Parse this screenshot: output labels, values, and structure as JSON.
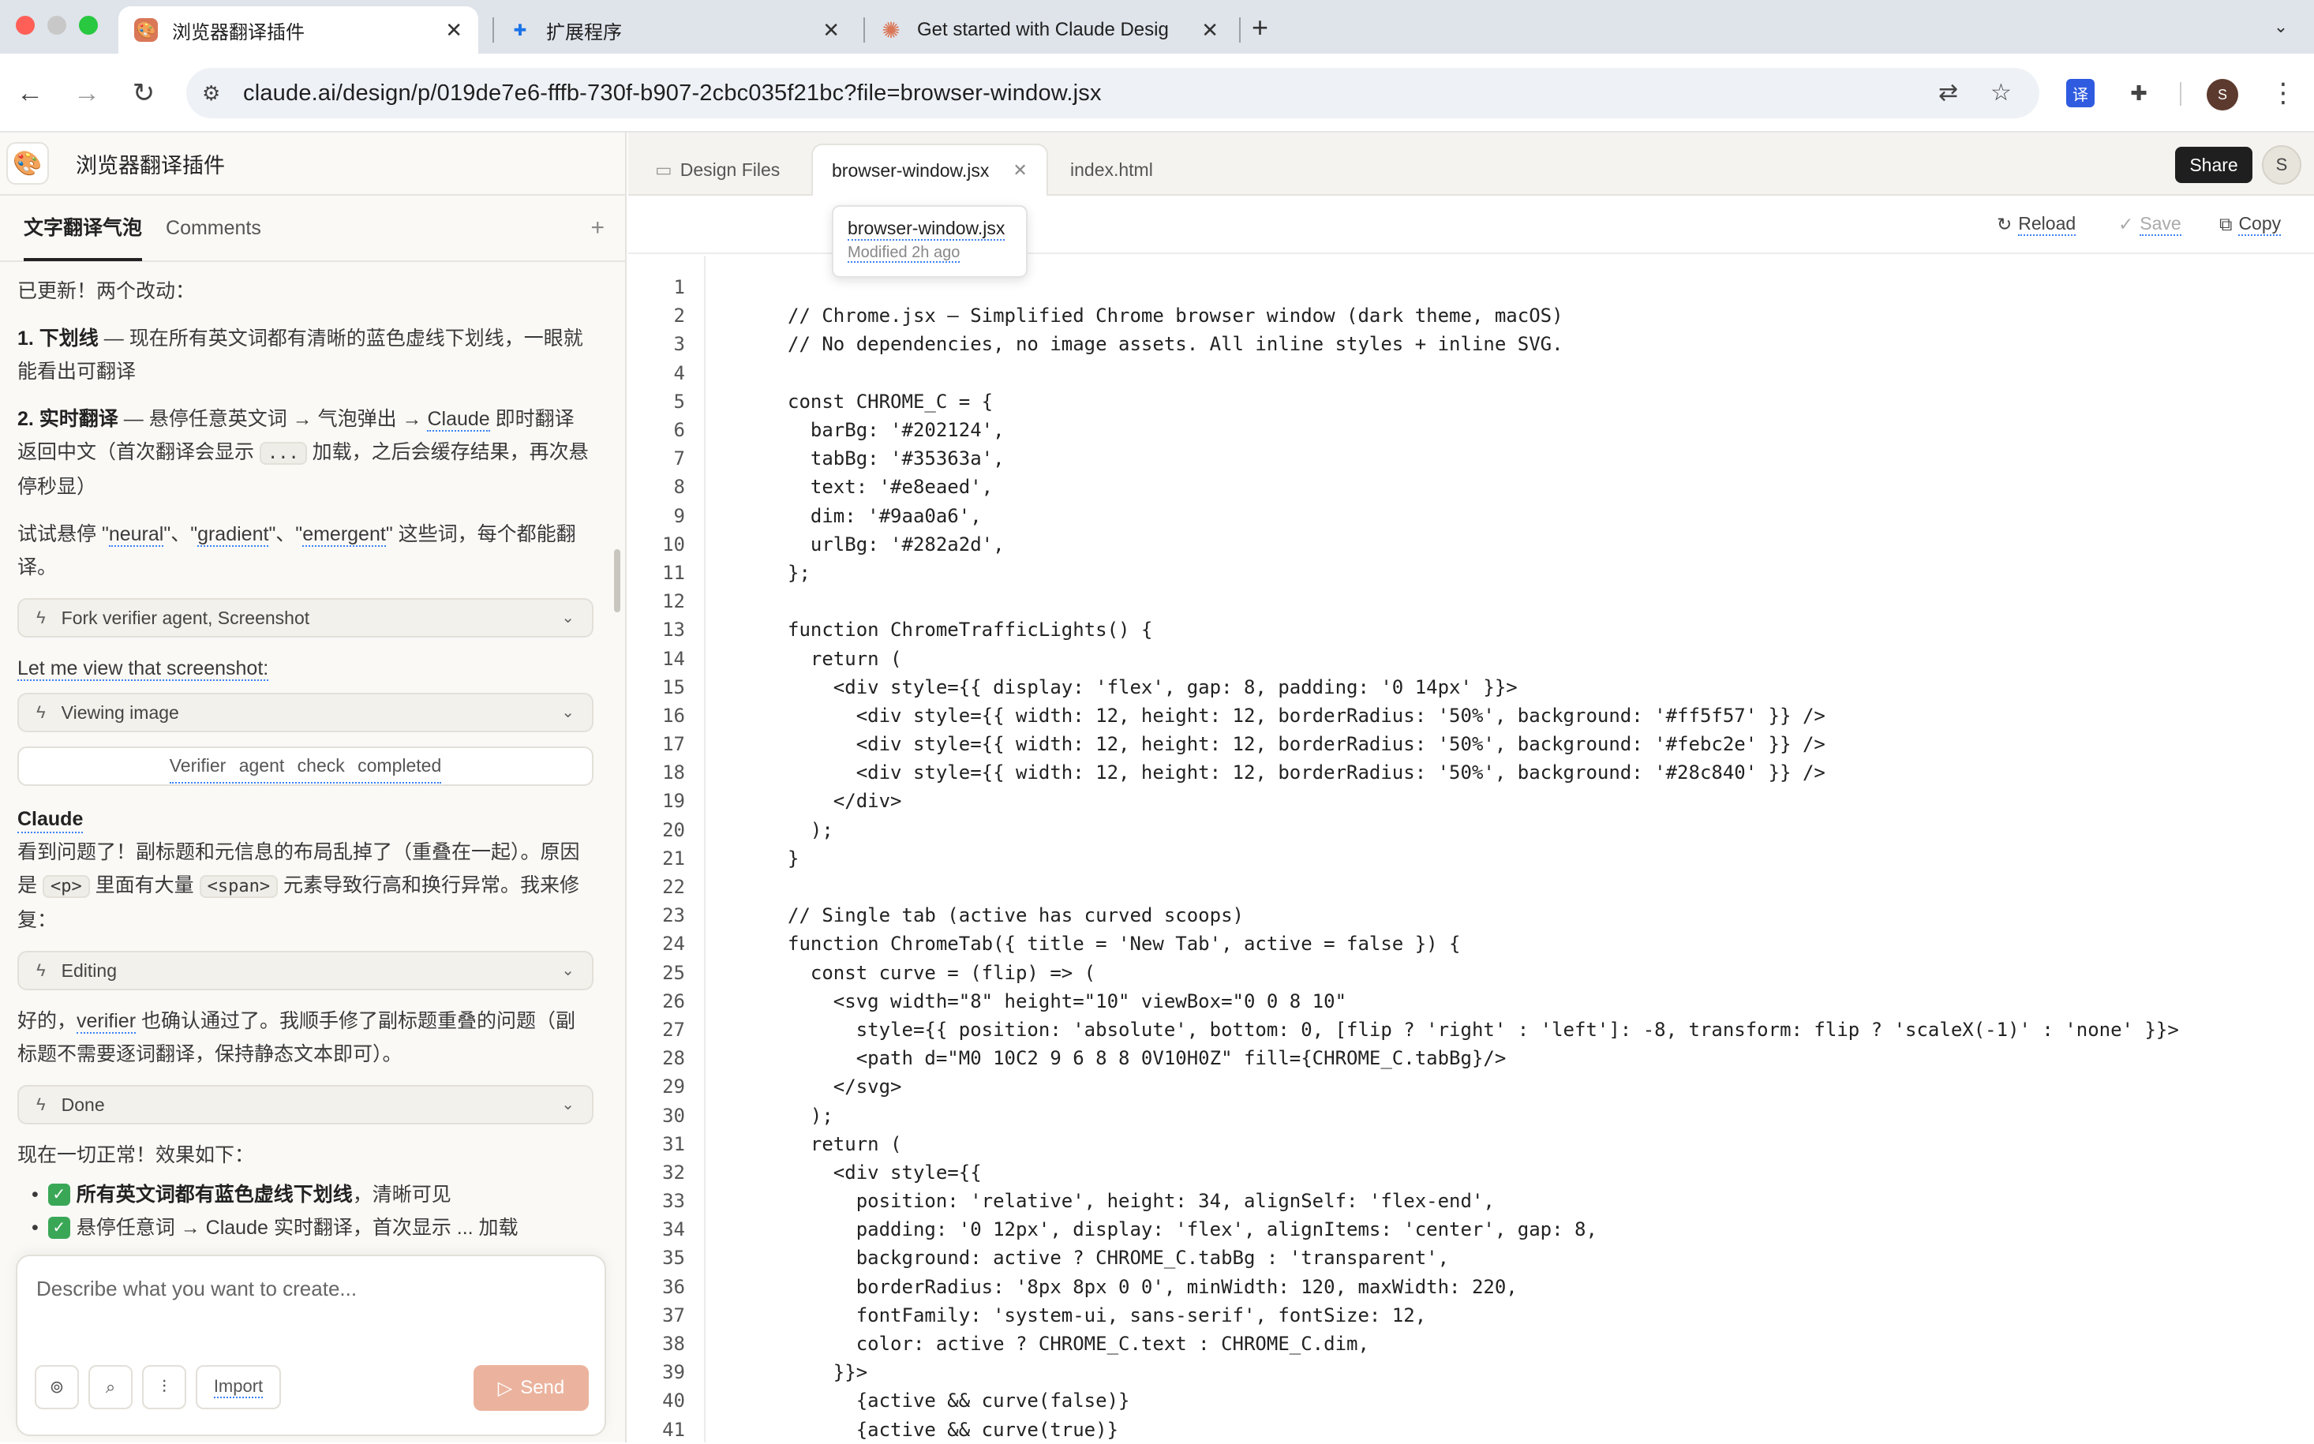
{
  "browser": {
    "tabs": [
      {
        "label": "浏览器翻译插件",
        "active": true
      },
      {
        "label": "扩展程序",
        "active": false
      },
      {
        "label": "Get started with Claude Desig",
        "active": false
      }
    ],
    "url": "claude.ai/design/p/019de7e6-fffb-730f-b907-2cbc035f21bc?file=browser-window.jsx",
    "profile_initial": "S",
    "translate_ext": "译"
  },
  "project": {
    "title": "浏览器翻译插件",
    "tabs": [
      {
        "label": "文字翻译气泡",
        "active": true
      },
      {
        "label": "Comments",
        "active": false
      }
    ]
  },
  "chat": {
    "intro": "已更新！两个改动：",
    "change1_title": "1. 下划线",
    "change1_text": " — 现在所有英文词都有清晰的蓝色虚线下划线，一眼就能看出可翻译",
    "change2_title": "2. 实时翻译",
    "change2_text_a": " — 悬停任意英文词 → 气泡弹出 → ",
    "change2_claude": "Claude",
    "change2_text_b": " 即时翻译返回中文（首次翻译会显示 ",
    "change2_code": "...",
    "change2_text_c": " 加载，之后会缓存结果，再次悬停秒显）",
    "try_a": "试试悬停 \"",
    "try_w1": "neural",
    "try_b": "\"、\"",
    "try_w2": "gradient",
    "try_c": "\"、\"",
    "try_w3": "emergent",
    "try_d": "\" 这些词，每个都能翻译。",
    "tool1": "Fork verifier agent, Screenshot",
    "view_text": "Let me view that screenshot:",
    "tool2": "Viewing image",
    "verifier": "Verifier agent check completed",
    "claude_label": "Claude",
    "problem_a": "看到问题了！副标题和元信息的布局乱掉了（重叠在一起）。原因是 ",
    "problem_code1": "<p>",
    "problem_b": " 里面有大量 ",
    "problem_code2": "<span>",
    "problem_c": " 元素导致行高和换行异常。我来修复：",
    "tool3": "Editing",
    "fixed_a": "好的，",
    "fixed_verifier": "verifier",
    "fixed_b": " 也确认通过了。我顺手修了副标题重叠的问题（副标题不需要逐词翻译，保持静态文本即可）。",
    "tool4": "Done",
    "summary": "现在一切正常！效果如下：",
    "bullet1_bold": "所有英文词都有蓝色虚线下划线",
    "bullet1_rest": "，清晰可见",
    "bullet2": "悬停任意词 → Claude 实时翻译，首次显示 ... 加载"
  },
  "composer": {
    "placeholder": "Describe what you want to create...",
    "import_label": "Import",
    "send_label": "Send"
  },
  "editor": {
    "file_tabs": [
      {
        "label": "Design Files",
        "active": false
      },
      {
        "label": "browser-window.jsx",
        "active": true
      },
      {
        "label": "index.html",
        "active": false
      }
    ],
    "share_label": "Share",
    "avatar": "S",
    "reload_label": "Reload",
    "save_label": "Save",
    "copy_label": "Copy",
    "tooltip_name": "browser-window.jsx",
    "tooltip_meta": "Modified 2h ago",
    "lines": [
      "",
      "// Chrome.jsx — Simplified Chrome browser window (dark theme, macOS)",
      "// No dependencies, no image assets. All inline styles + inline SVG.",
      "",
      "const CHROME_C = {",
      "  barBg: '#202124',",
      "  tabBg: '#35363a',",
      "  text: '#e8eaed',",
      "  dim: '#9aa0a6',",
      "  urlBg: '#282a2d',",
      "};",
      "",
      "function ChromeTrafficLights() {",
      "  return (",
      "    <div style={{ display: 'flex', gap: 8, padding: '0 14px' }}>",
      "      <div style={{ width: 12, height: 12, borderRadius: '50%', background: '#ff5f57' }} />",
      "      <div style={{ width: 12, height: 12, borderRadius: '50%', background: '#febc2e' }} />",
      "      <div style={{ width: 12, height: 12, borderRadius: '50%', background: '#28c840' }} />",
      "    </div>",
      "  );",
      "}",
      "",
      "// Single tab (active has curved scoops)",
      "function ChromeTab({ title = 'New Tab', active = false }) {",
      "  const curve = (flip) => (",
      "    <svg width=\"8\" height=\"10\" viewBox=\"0 0 8 10\"",
      "      style={{ position: 'absolute', bottom: 0, [flip ? 'right' : 'left']: -8, transform: flip ? 'scaleX(-1)' : 'none' }}>",
      "      <path d=\"M0 10C2 9 6 8 8 0V10H0Z\" fill={CHROME_C.tabBg}/>",
      "    </svg>",
      "  );",
      "  return (",
      "    <div style={{",
      "      position: 'relative', height: 34, alignSelf: 'flex-end',",
      "      padding: '0 12px', display: 'flex', alignItems: 'center', gap: 8,",
      "      background: active ? CHROME_C.tabBg : 'transparent',",
      "      borderRadius: '8px 8px 0 0', minWidth: 120, maxWidth: 220,",
      "      fontFamily: 'system-ui, sans-serif', fontSize: 12,",
      "      color: active ? CHROME_C.text : CHROME_C.dim,",
      "    }}>",
      "      {active && curve(false)}",
      "      {active && curve(true)}"
    ]
  },
  "colors": {
    "accent": "#d97757",
    "send_bg": "#ebb39e",
    "link_underline": "#3b82f6",
    "traffic_red": "#ff5f57",
    "traffic_yellow": "#febc2e",
    "traffic_green": "#28c840"
  }
}
